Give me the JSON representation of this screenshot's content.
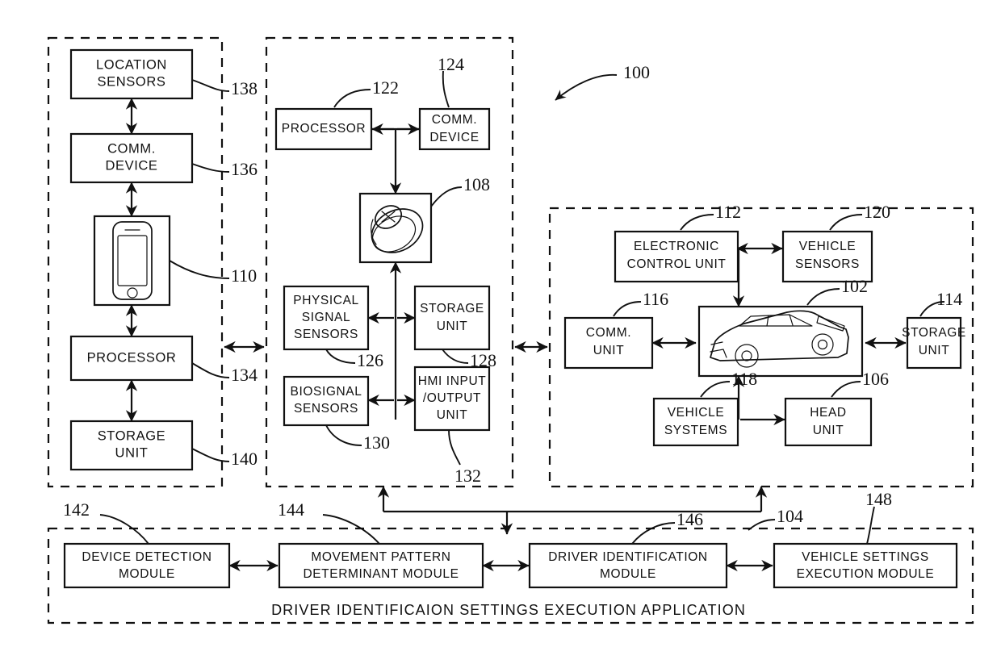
{
  "figure": {
    "title_ref": "100",
    "caption": "DRIVER  IDENTIFICAION  SETTINGS  EXECUTION  APPLICATION"
  },
  "portable_device_panel": {
    "name": "portable-device-panel",
    "boxes": [
      {
        "id": "location-sensors",
        "label_line1": "LOCATION",
        "label_line2": "SENSORS",
        "ref": "138"
      },
      {
        "id": "comm-device",
        "label_line1": "COMM.",
        "label_line2": "DEVICE",
        "ref": "136"
      },
      {
        "id": "portable-device-image",
        "label_line1": "",
        "label_line2": "",
        "ref": "110",
        "icon": "smartphone-icon"
      },
      {
        "id": "processor",
        "label_line1": "PROCESSOR",
        "label_line2": "",
        "ref": "134"
      },
      {
        "id": "storage-unit",
        "label_line1": "STORAGE",
        "label_line2": "UNIT",
        "ref": "140"
      }
    ]
  },
  "wearable_device_panel": {
    "name": "wearable-device-panel",
    "boxes": [
      {
        "id": "processor",
        "label_line1": "PROCESSOR",
        "label_line2": "",
        "ref": "122"
      },
      {
        "id": "comm-device",
        "label_line1": "COMM.",
        "label_line2": "DEVICE",
        "ref": "124"
      },
      {
        "id": "wearable-device-image",
        "label_line1": "",
        "label_line2": "",
        "ref": "108",
        "icon": "smartwatch-icon"
      },
      {
        "id": "physical-signal-sensors",
        "label_line1": "PHYSICAL",
        "label_line2": "SIGNAL",
        "label_line3": "SENSORS",
        "ref": "126"
      },
      {
        "id": "storage-unit",
        "label_line1": "STORAGE",
        "label_line2": "UNIT",
        "ref": "128"
      },
      {
        "id": "biosignal-sensors",
        "label_line1": "BIOSIGNAL",
        "label_line2": "SENSORS",
        "ref": "130"
      },
      {
        "id": "hmi-input-output-unit",
        "label_line1": "HMI INPUT",
        "label_line2": "/OUTPUT",
        "label_line3": "UNIT",
        "ref": "132"
      }
    ]
  },
  "vehicle_panel": {
    "name": "vehicle-panel",
    "boxes": [
      {
        "id": "electronic-control-unit",
        "label_line1": "ELECTRONIC",
        "label_line2": "CONTROL  UNIT",
        "ref": "112"
      },
      {
        "id": "vehicle-sensors",
        "label_line1": "VEHICLE",
        "label_line2": "SENSORS",
        "ref": "120"
      },
      {
        "id": "comm-unit",
        "label_line1": "COMM.",
        "label_line2": "UNIT",
        "ref": "116"
      },
      {
        "id": "vehicle-image",
        "label_line1": "",
        "label_line2": "",
        "ref": "102",
        "icon": "car-icon"
      },
      {
        "id": "storage-unit",
        "label_line1": "STORAGE",
        "label_line2": "UNIT",
        "ref": "114"
      },
      {
        "id": "vehicle-systems",
        "label_line1": "VEHICLE",
        "label_line2": "SYSTEMS",
        "ref": "118"
      },
      {
        "id": "head-unit",
        "label_line1": "HEAD",
        "label_line2": "UNIT",
        "ref": "106"
      }
    ]
  },
  "application_panel": {
    "name": "application-panel",
    "ref": "104",
    "boxes": [
      {
        "id": "device-detection-module",
        "label_line1": "DEVICE DETECTION",
        "label_line2": "MODULE",
        "ref": "142"
      },
      {
        "id": "movement-pattern-determinant-module",
        "label_line1": "MOVEMENT PATTERN",
        "label_line2": "DETERMINANT MODULE",
        "ref": "144"
      },
      {
        "id": "driver-identification-module",
        "label_line1": "DRIVER  IDENTIFICATION",
        "label_line2": "MODULE",
        "ref": "146"
      },
      {
        "id": "vehicle-settings-execution-module",
        "label_line1": "VEHICLE  SETTINGS",
        "label_line2": "EXECUTION  MODULE",
        "ref": "148"
      }
    ]
  },
  "colors": {
    "line": "#111111",
    "background": "#ffffff"
  }
}
